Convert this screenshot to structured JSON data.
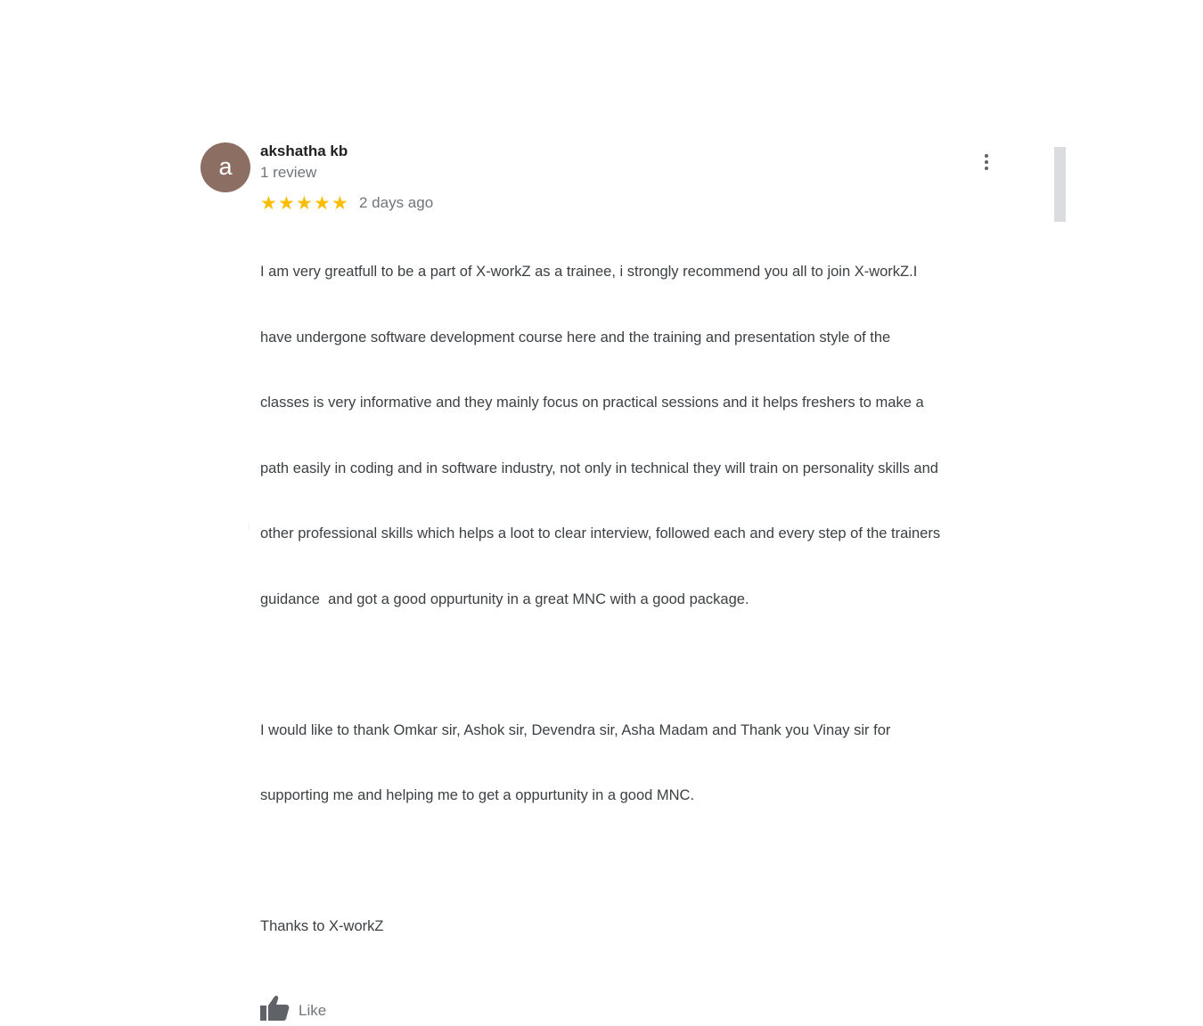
{
  "review": {
    "avatar_letter": "a",
    "avatar_color": "#8d6e63",
    "author_name": "akshatha kb",
    "review_count": "1 review",
    "rating": 5,
    "rating_max": 5,
    "date": "2 days ago",
    "text_lines_p1": [
      "I am very greatfull to be a part of X-workZ as a trainee, i strongly recommend you all to join X-workZ.I",
      "have undergone software development course here and the training and presentation style of the",
      "classes is very informative and they mainly focus on practical sessions and it helps freshers to make a",
      "path easily in coding and in software industry, not only in technical they will train on personality skills and",
      "other professional skills which helps a loot to clear interview, followed each and every step of the trainers",
      "guidance  and got a good oppurtunity in a great MNC with a good package."
    ],
    "text_lines_p2": [
      "I would like to thank Omkar sir, Ashok sir, Devendra sir, Asha Madam and Thank you Vinay sir for",
      "supporting me and helping me to get a oppurtunity in a good MNC."
    ],
    "text_lines_p3": [
      "Thanks to X-workZ"
    ],
    "like_label": "Like",
    "like_icon": "thumbs-up-icon",
    "more_icon": "more-vert-icon"
  },
  "colors": {
    "star": "#fbbc04",
    "text": "#3c4043",
    "secondary_text": "#70757a",
    "scrollbar": "#dadce0"
  }
}
